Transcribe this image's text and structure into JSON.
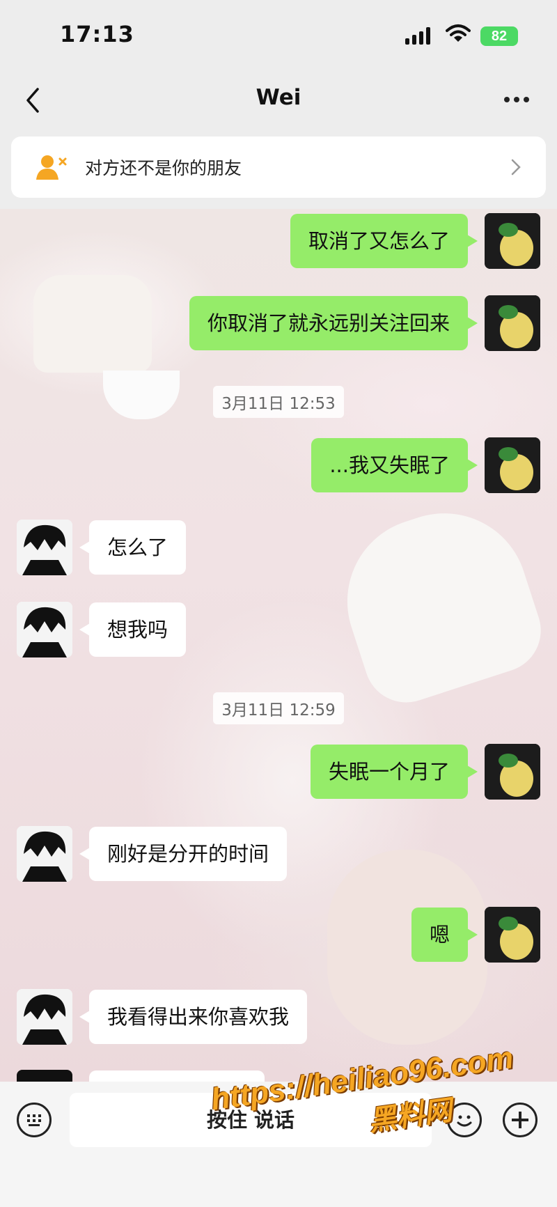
{
  "status_bar": {
    "time": "17:13",
    "battery": "82"
  },
  "nav": {
    "title": "Wei"
  },
  "banner": {
    "text": "对方还不是你的朋友"
  },
  "messages": [
    {
      "side": "me",
      "text": "取消了又怎么了"
    },
    {
      "side": "me",
      "text": "你取消了就永远别关注回来"
    },
    {
      "type": "time",
      "text": "3月11日 12:53"
    },
    {
      "side": "me",
      "text": "...我又失眠了"
    },
    {
      "side": "them",
      "text": "怎么了"
    },
    {
      "side": "them",
      "text": "想我吗"
    },
    {
      "type": "time",
      "text": "3月11日 12:59"
    },
    {
      "side": "me",
      "text": "失眠一个月了"
    },
    {
      "side": "them",
      "text": "刚好是分开的时间"
    },
    {
      "side": "me",
      "text": "嗯"
    },
    {
      "side": "them",
      "text": "我看得出来你喜欢我"
    }
  ],
  "input": {
    "hold_to_talk": "按住 说话"
  },
  "watermark": {
    "url": "https://heiliao96.com",
    "name": "黑料网"
  }
}
